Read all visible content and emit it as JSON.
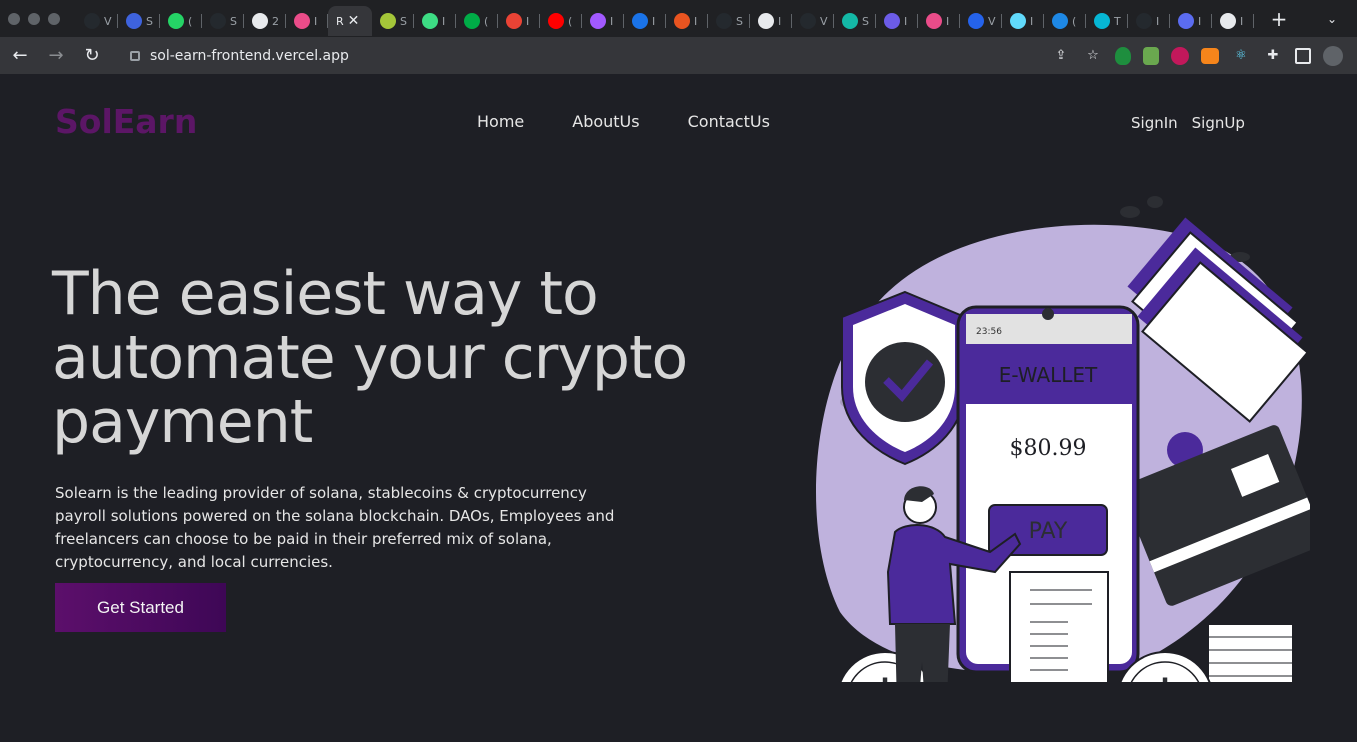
{
  "browser": {
    "tabs": [
      {
        "label": "V",
        "color": "#24292e"
      },
      {
        "label": "S",
        "color": "#3e63dd"
      },
      {
        "label": "(",
        "color": "#25d366"
      },
      {
        "label": "S",
        "color": "#24292e"
      },
      {
        "label": "2",
        "color": "#e8eaed"
      },
      {
        "label": "I",
        "color": "#ea4c89"
      },
      {
        "label": "R",
        "color": "#9aa0a6",
        "active": true
      },
      {
        "label": "S",
        "color": "#a4c639"
      },
      {
        "label": "I",
        "color": "#3ddc84"
      },
      {
        "label": "(",
        "color": "#00ac47"
      },
      {
        "label": "I",
        "color": "#ea4335"
      },
      {
        "label": "(",
        "color": "#ff0000"
      },
      {
        "label": "I",
        "color": "#a259ff"
      },
      {
        "label": "I",
        "color": "#1a73e8"
      },
      {
        "label": "I",
        "color": "#e95420"
      },
      {
        "label": "S",
        "color": "#24292e"
      },
      {
        "label": "I",
        "color": "#e8eaed"
      },
      {
        "label": "V",
        "color": "#24292e"
      },
      {
        "label": "S",
        "color": "#14b8a6"
      },
      {
        "label": "I",
        "color": "#6c5ce7"
      },
      {
        "label": "I",
        "color": "#ea4c89"
      },
      {
        "label": "V",
        "color": "#2563eb"
      },
      {
        "label": "I",
        "color": "#61dafb"
      },
      {
        "label": "(",
        "color": "#1e88e5"
      },
      {
        "label": "T",
        "color": "#06b6d4"
      },
      {
        "label": "I",
        "color": "#24292e"
      },
      {
        "label": "I",
        "color": "#5b6cf0"
      },
      {
        "label": "I",
        "color": "#e8eaed"
      }
    ],
    "active_tab_close": "✕",
    "new_tab": "+",
    "tab_menu": "⌄",
    "url": "sol-earn-frontend.vercel.app"
  },
  "site": {
    "logo": "SolEarn",
    "nav": [
      "Home",
      "AboutUs",
      "ContactUs"
    ],
    "signin": "SignIn",
    "signup": "SignUp",
    "headline": "The easiest way to automate your crypto payment",
    "description": "Solearn is the leading provider of solana, stablecoins & cryptocurrency payroll solutions powered on the solana blockchain. DAOs, Employees and freelancers can choose to be paid in their preferred mix of solana, cryptocurrency, and local currencies.",
    "cta": "Get Started",
    "accent": "#5c1666"
  },
  "illustration": {
    "time": "23:56",
    "wallet_title": "E-WALLET",
    "amount": "$80.99",
    "pay_label": "PAY",
    "dollar": "$",
    "purple": "#4b2a9b",
    "lavender": "#bfb2dd"
  }
}
